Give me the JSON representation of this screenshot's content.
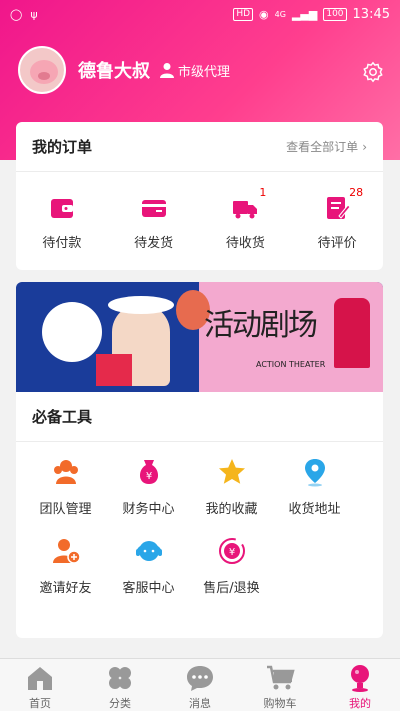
{
  "status_bar": {
    "battery": "100",
    "time": "13:45",
    "hd_label": "HD",
    "network": "4G"
  },
  "profile": {
    "name": "德鲁大叔",
    "role": "市级代理"
  },
  "orders": {
    "title": "我的订单",
    "view_all": "查看全部订单",
    "items": [
      {
        "label": "待付款",
        "badge": "",
        "icon": "wallet-icon"
      },
      {
        "label": "待发货",
        "badge": "",
        "icon": "card-icon"
      },
      {
        "label": "待收货",
        "badge": "1",
        "icon": "truck-icon"
      },
      {
        "label": "待评价",
        "badge": "28",
        "icon": "review-icon"
      }
    ]
  },
  "banner": {
    "title": "活动剧场",
    "subtitle": "ACTION THEATER"
  },
  "tools": {
    "title": "必备工具",
    "items": [
      {
        "label": "团队管理",
        "icon": "team-icon"
      },
      {
        "label": "财务中心",
        "icon": "money-bag-icon"
      },
      {
        "label": "我的收藏",
        "icon": "star-icon"
      },
      {
        "label": "收货地址",
        "icon": "location-pin-icon"
      },
      {
        "label": "邀请好友",
        "icon": "invite-user-icon"
      },
      {
        "label": "客服中心",
        "icon": "headset-icon"
      },
      {
        "label": "售后/退换",
        "icon": "refund-icon"
      }
    ]
  },
  "tabbar": {
    "items": [
      {
        "label": "首页",
        "icon": "home-icon"
      },
      {
        "label": "分类",
        "icon": "category-icon"
      },
      {
        "label": "消息",
        "icon": "message-icon"
      },
      {
        "label": "购物车",
        "icon": "cart-icon"
      },
      {
        "label": "我的",
        "icon": "profile-icon",
        "active": true
      }
    ]
  },
  "colors": {
    "brand": "#f0168b",
    "accent_orange": "#f26b2a",
    "star": "#f5b51c",
    "location": "#2aa6e8",
    "active_tab": "#e8157a"
  }
}
